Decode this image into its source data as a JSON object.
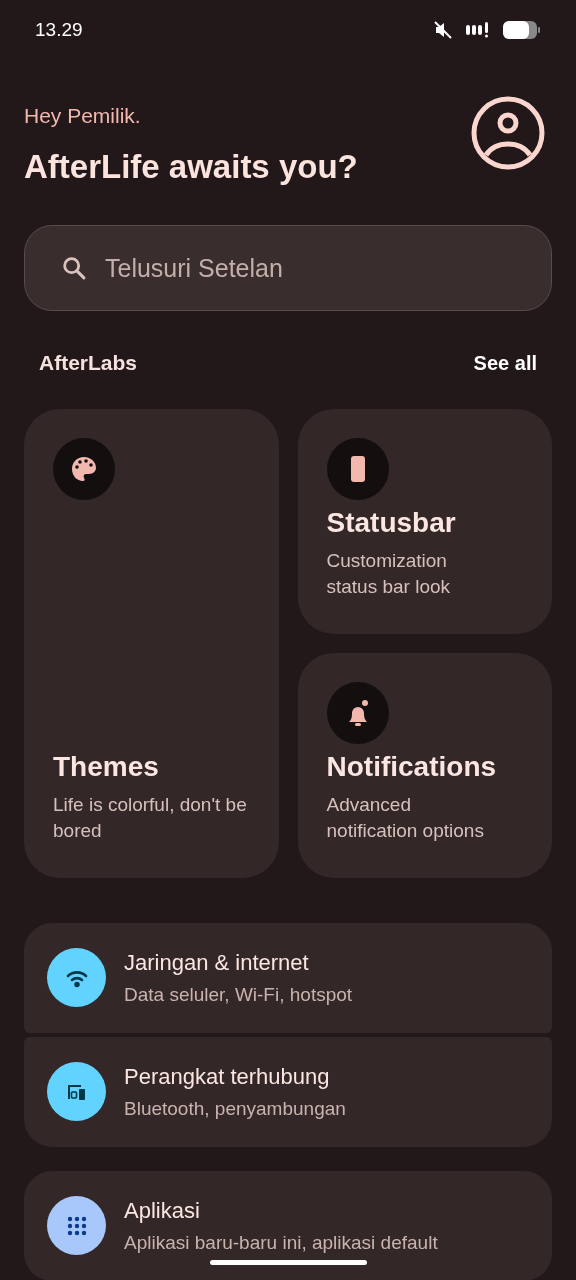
{
  "status_bar": {
    "time": "13.29"
  },
  "greeting": "Hey Pemilik.",
  "title": "AfterLife awaits you?",
  "search": {
    "placeholder": "Telusuri Setelan"
  },
  "section": {
    "title": "AfterLabs",
    "action": "See all"
  },
  "cards": [
    {
      "title": "Themes",
      "subtitle": "Life is colorful, don't be bored"
    },
    {
      "title": "Statusbar",
      "subtitle": "Customization status bar look"
    },
    {
      "title": "Notifications",
      "subtitle": "Advanced notification options"
    }
  ],
  "settings_groups": [
    {
      "items": [
        {
          "title": "Jaringan & internet",
          "subtitle": "Data seluler, Wi-Fi, hotspot",
          "color": "#62d2ff"
        },
        {
          "title": "Perangkat terhubung",
          "subtitle": "Bluetooth, penyambungan",
          "color": "#62d2ff"
        }
      ]
    },
    {
      "items": [
        {
          "title": "Aplikasi",
          "subtitle": "Aplikasi baru-baru ini, aplikasi default",
          "color": "#a8c7fa"
        }
      ]
    }
  ]
}
